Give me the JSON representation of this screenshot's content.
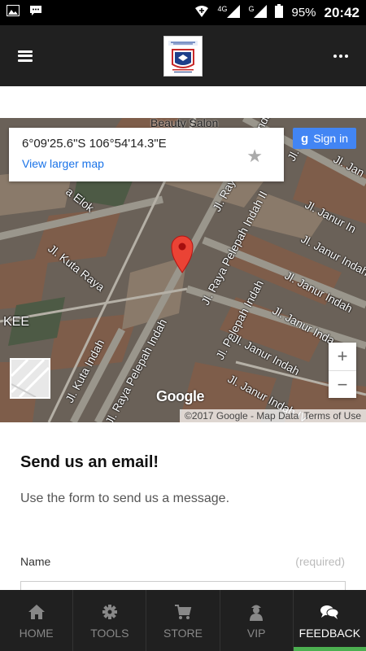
{
  "status_bar": {
    "network": "4G",
    "signal_label": "G",
    "battery": "95%",
    "time": "20:42"
  },
  "map": {
    "coordinates": "6°09'25.6\"S 106°54'14.3\"E",
    "view_larger": "View larger map",
    "sign_in": "Sign in",
    "zoom_in": "+",
    "zoom_out": "−",
    "google": "Google",
    "copyright": "©2017 Google - Map Data",
    "terms": "Terms of Use",
    "streets": {
      "beauty_salon": "Beauty Salon",
      "elok": "a Elok",
      "kuta_raya": "Jl. Kuta Raya",
      "kee": "KEE",
      "kuta_indah": "Jl. Kuta Indah",
      "raya_pelepah_indah_main": "Jl. Raya Pelepah Indah",
      "raya_pelepah_indah_top": "Jl. Raya Pelepah Indah",
      "raya_pelepah_indah_ii": "Jl. Raya Pelepah Indah II",
      "pelepah_indah": "Jl. Pelepah Indah",
      "janur_indah_iv": "Jl. Janur Indah IV",
      "janur_indah_lower": "Jl. Janur Indah",
      "janur_indah_a": "Jl. Janur Indah",
      "janur_indah_b": "Jl. Janur Indah",
      "janur_indah_c": "Jl. Janur Inda",
      "janur_top1": "Jl. Janur In",
      "janur_top2": "Jl. Janur In",
      "jl_r": "Jl. J",
      "jl_jan": "Jl. Jan"
    }
  },
  "content": {
    "title": "Send us an email!",
    "subtitle": "Use the form to send us a message.",
    "name_label": "Name",
    "required": "(required)"
  },
  "nav": {
    "home": "HOME",
    "tools": "TOOLS",
    "store": "STORE",
    "vip": "VIP",
    "feedback": "FEEDBACK"
  },
  "colors": {
    "accent": "#4caf50",
    "link": "#1a73e8",
    "header_bg": "#202020"
  }
}
